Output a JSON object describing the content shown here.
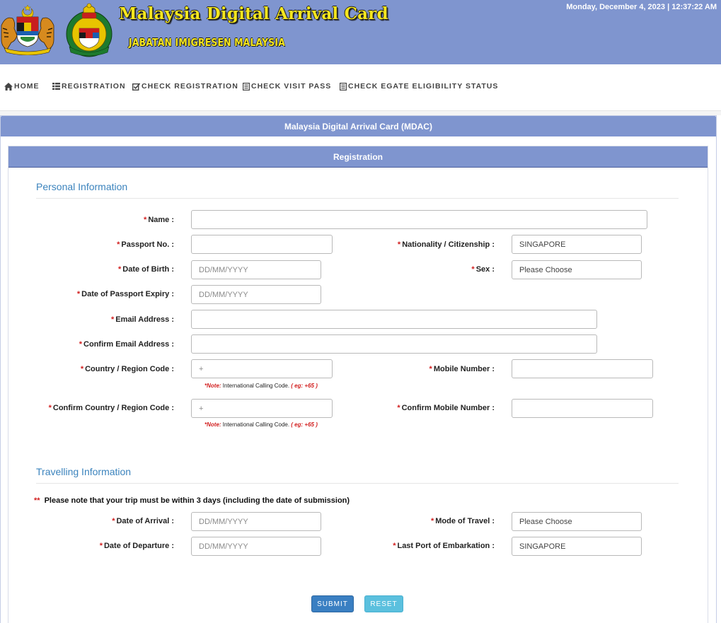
{
  "header": {
    "datetime": "Monday, December 4, 2023 | 12:37:22 AM",
    "title": "Malaysia Digital Arrival Card",
    "subtitle": "JABATAN IMIGRESEN MALAYSIA",
    "emblem_coat": "malaysia-coat-of-arms",
    "emblem_immigration": "immigration-department-crest"
  },
  "nav": [
    {
      "label": "HOME",
      "icon": "home-icon"
    },
    {
      "label": "REGISTRATION",
      "icon": "list-icon"
    },
    {
      "label": "CHECK REGISTRATION",
      "icon": "check-square-icon"
    },
    {
      "label": "CHECK VISIT PASS",
      "icon": "document-list-icon"
    },
    {
      "label": "CHECK EGATE ELIGIBILITY STATUS",
      "icon": "document-list-icon"
    }
  ],
  "panel": {
    "title": "Malaysia Digital Arrival Card (MDAC)",
    "subtitle": "Registration"
  },
  "personal": {
    "section_title": "Personal Information",
    "name_label": "Name :",
    "passport_label": "Passport No. :",
    "nationality_label": "Nationality / Citizenship :",
    "nationality_value": "SINGAPORE",
    "dob_label": "Date of Birth :",
    "dob_placeholder": "DD/MM/YYYY",
    "sex_label": "Sex :",
    "sex_value": "Please Choose",
    "expiry_label": "Date of Passport Expiry :",
    "expiry_placeholder": "DD/MM/YYYY",
    "email_label": "Email Address :",
    "confirm_email_label": "Confirm Email Address :",
    "region_label": "Country / Region Code :",
    "region_placeholder": "+",
    "mobile_label": "Mobile Number :",
    "confirm_region_label": "Confirm Country / Region Code :",
    "confirm_region_placeholder": "+",
    "confirm_mobile_label": "Confirm Mobile Number :",
    "note_prefix": "*Note:",
    "note_text": " International Calling Code. ",
    "note_example": "( eg: +65 )"
  },
  "travel": {
    "section_title": "Travelling Information",
    "trip_note_marker": "**",
    "trip_note": "Please note that your trip must be within 3 days (including the date of submission)",
    "arrival_label": "Date of Arrival :",
    "arrival_placeholder": "DD/MM/YYYY",
    "mode_label": "Mode of Travel :",
    "mode_value": "Please Choose",
    "departure_label": "Date of Departure :",
    "departure_placeholder": "DD/MM/YYYY",
    "port_label": "Last Port of Embarkation :",
    "port_value": "SINGAPORE"
  },
  "actions": {
    "submit": "SUBMIT",
    "reset": "RESET"
  },
  "colors": {
    "header_bg": "#7f95cf",
    "title_yellow": "#f5e61e",
    "section_blue": "#3b83bd",
    "required_red": "#d21f1f",
    "submit_blue": "#3a7fc2",
    "reset_cyan": "#5bc0de"
  }
}
